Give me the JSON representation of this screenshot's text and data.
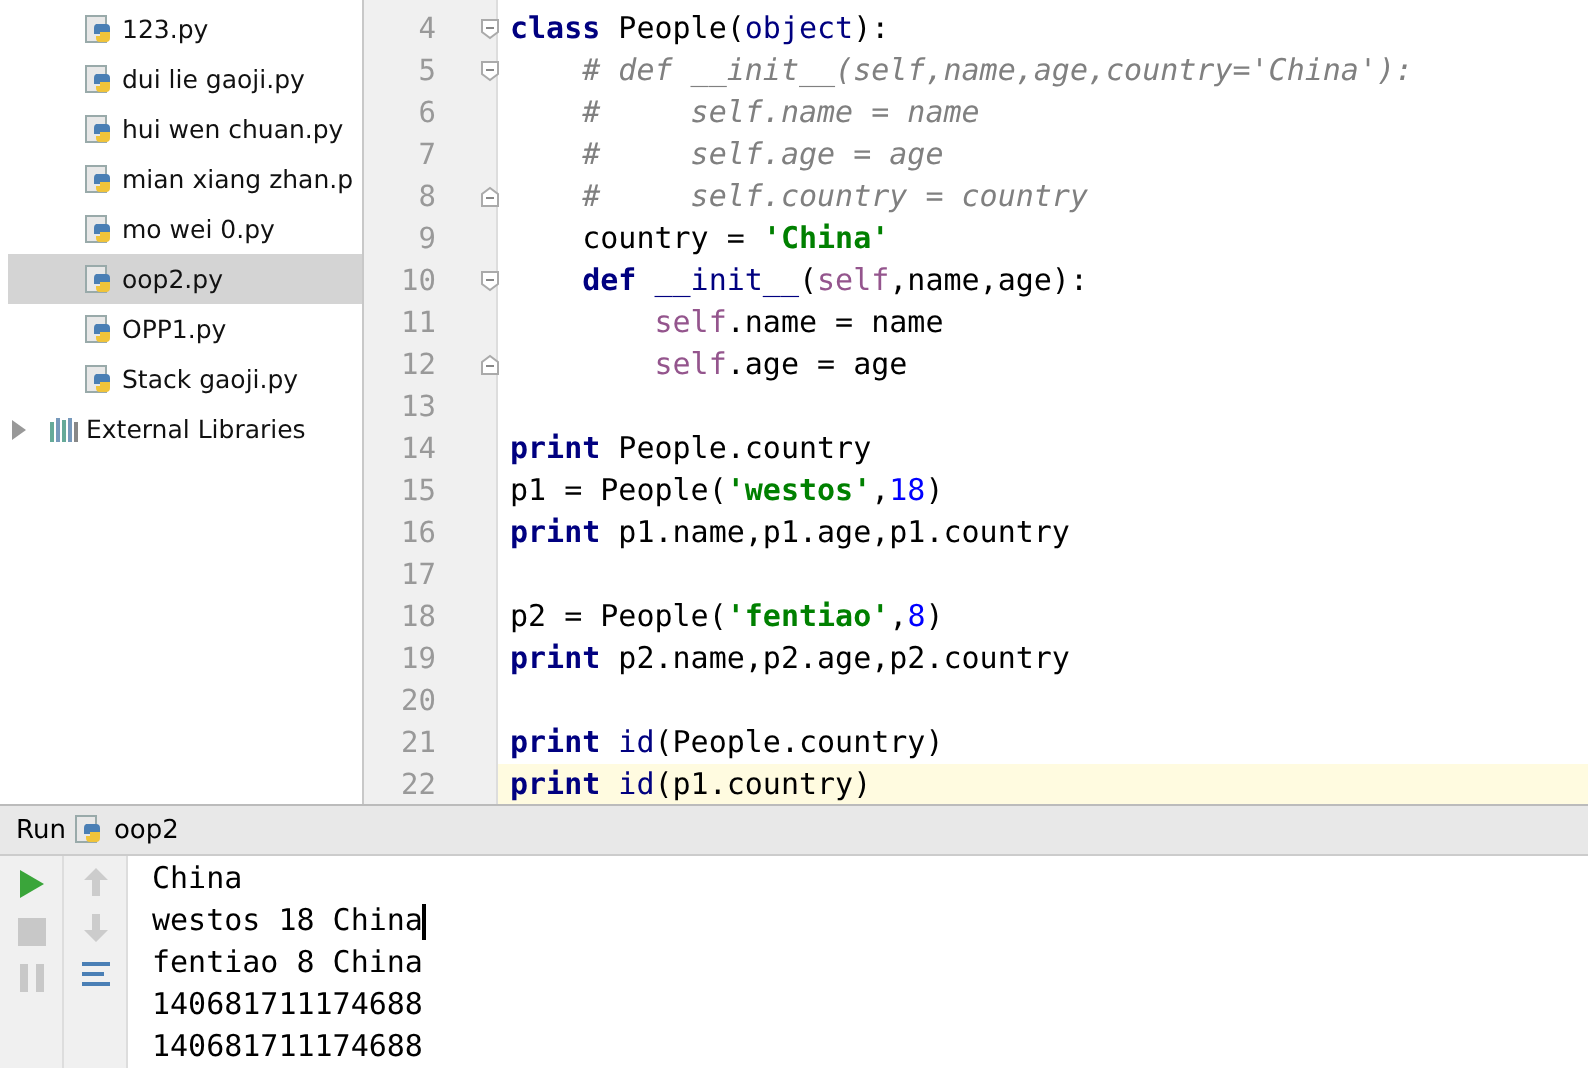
{
  "project_tree": {
    "items": [
      {
        "kind": "python-file",
        "label": "123.py",
        "selected": false
      },
      {
        "kind": "python-file",
        "label": "dui lie gaoji.py",
        "selected": false
      },
      {
        "kind": "python-file",
        "label": "hui wen chuan.py",
        "selected": false
      },
      {
        "kind": "python-file",
        "label": "mian xiang zhan.p",
        "selected": false
      },
      {
        "kind": "python-file",
        "label": "mo wei 0.py",
        "selected": false
      },
      {
        "kind": "python-file",
        "label": "oop2.py",
        "selected": true
      },
      {
        "kind": "python-file",
        "label": "OPP1.py",
        "selected": false
      },
      {
        "kind": "python-file",
        "label": "Stack gaoji.py",
        "selected": false
      },
      {
        "kind": "library",
        "label": "External Libraries",
        "selected": false,
        "expanded": false
      }
    ]
  },
  "editor": {
    "lines": [
      {
        "number": "4",
        "fold_start": true,
        "fold_end": false,
        "current": false,
        "tokens": [
          {
            "kind": "kw",
            "text": "class"
          },
          {
            "kind": "plain",
            "text": " People("
          },
          {
            "kind": "builtin",
            "text": "object"
          },
          {
            "kind": "plain",
            "text": "):"
          }
        ]
      },
      {
        "number": "5",
        "fold_start": true,
        "fold_end": false,
        "current": false,
        "tokens": [
          {
            "kind": "comment",
            "text": "    # def __init__(self,name,age,country='China'):"
          }
        ]
      },
      {
        "number": "6",
        "fold_start": false,
        "fold_end": false,
        "current": false,
        "tokens": [
          {
            "kind": "comment",
            "text": "    #     self.name = name"
          }
        ]
      },
      {
        "number": "7",
        "fold_start": false,
        "fold_end": false,
        "current": false,
        "tokens": [
          {
            "kind": "comment",
            "text": "    #     self.age = age"
          }
        ]
      },
      {
        "number": "8",
        "fold_start": false,
        "fold_end": true,
        "current": false,
        "tokens": [
          {
            "kind": "comment",
            "text": "    #     self.country = country"
          }
        ]
      },
      {
        "number": "9",
        "fold_start": false,
        "fold_end": false,
        "current": false,
        "tokens": [
          {
            "kind": "plain",
            "text": "    country = "
          },
          {
            "kind": "str",
            "text": "'China'"
          }
        ]
      },
      {
        "number": "10",
        "fold_start": true,
        "fold_end": false,
        "current": false,
        "tokens": [
          {
            "kind": "kw",
            "text": "    def"
          },
          {
            "kind": "builtin",
            "text": " __init__"
          },
          {
            "kind": "plain",
            "text": "("
          },
          {
            "kind": "self",
            "text": "self"
          },
          {
            "kind": "plain",
            "text": ",name,age):"
          }
        ]
      },
      {
        "number": "11",
        "fold_start": false,
        "fold_end": false,
        "current": false,
        "tokens": [
          {
            "kind": "self",
            "text": "        self"
          },
          {
            "kind": "plain",
            "text": ".name = name"
          }
        ]
      },
      {
        "number": "12",
        "fold_start": false,
        "fold_end": true,
        "current": false,
        "tokens": [
          {
            "kind": "self",
            "text": "        self"
          },
          {
            "kind": "plain",
            "text": ".age = age"
          }
        ]
      },
      {
        "number": "13",
        "fold_start": false,
        "fold_end": false,
        "current": false
      },
      {
        "number": "14",
        "fold_start": false,
        "fold_end": false,
        "current": false,
        "tokens": [
          {
            "kind": "kw",
            "text": "print"
          },
          {
            "kind": "plain",
            "text": " People.country"
          }
        ]
      },
      {
        "number": "15",
        "fold_start": false,
        "fold_end": false,
        "current": false,
        "tokens": [
          {
            "kind": "plain",
            "text": "p1 = People("
          },
          {
            "kind": "str",
            "text": "'westos'"
          },
          {
            "kind": "plain",
            "text": ","
          },
          {
            "kind": "num",
            "text": "18"
          },
          {
            "kind": "plain",
            "text": ")"
          }
        ]
      },
      {
        "number": "16",
        "fold_start": false,
        "fold_end": false,
        "current": false,
        "tokens": [
          {
            "kind": "kw",
            "text": "print"
          },
          {
            "kind": "plain",
            "text": " p1.name,p1.age,p1.country"
          }
        ]
      },
      {
        "number": "17",
        "fold_start": false,
        "fold_end": false,
        "current": false
      },
      {
        "number": "18",
        "fold_start": false,
        "fold_end": false,
        "current": false,
        "tokens": [
          {
            "kind": "plain",
            "text": "p2 = People("
          },
          {
            "kind": "str",
            "text": "'fentiao'"
          },
          {
            "kind": "plain",
            "text": ","
          },
          {
            "kind": "num",
            "text": "8"
          },
          {
            "kind": "plain",
            "text": ")"
          }
        ]
      },
      {
        "number": "19",
        "fold_start": false,
        "fold_end": false,
        "current": false,
        "tokens": [
          {
            "kind": "kw",
            "text": "print"
          },
          {
            "kind": "plain",
            "text": " p2.name,p2.age,p2.country"
          }
        ]
      },
      {
        "number": "20",
        "fold_start": false,
        "fold_end": false,
        "current": false
      },
      {
        "number": "21",
        "fold_start": false,
        "fold_end": false,
        "current": false,
        "tokens": [
          {
            "kind": "kw",
            "text": "print"
          },
          {
            "kind": "builtin",
            "text": " id"
          },
          {
            "kind": "plain",
            "text": "(People.country)"
          }
        ]
      },
      {
        "number": "22",
        "fold_start": false,
        "fold_end": false,
        "current": true,
        "tokens": [
          {
            "kind": "kw",
            "text": "print"
          },
          {
            "kind": "builtin",
            "text": " id"
          },
          {
            "kind": "plain",
            "text": "(p1.country)"
          }
        ]
      }
    ]
  },
  "run_panel": {
    "label": "Run",
    "config": "oop2",
    "output": [
      {
        "text": "China",
        "caret": false
      },
      {
        "text": "westos 18 China",
        "caret": true
      },
      {
        "text": "fentiao 8 China",
        "caret": false
      },
      {
        "text": "140681711174688",
        "caret": false
      },
      {
        "text": "140681711174688",
        "caret": false
      }
    ]
  }
}
